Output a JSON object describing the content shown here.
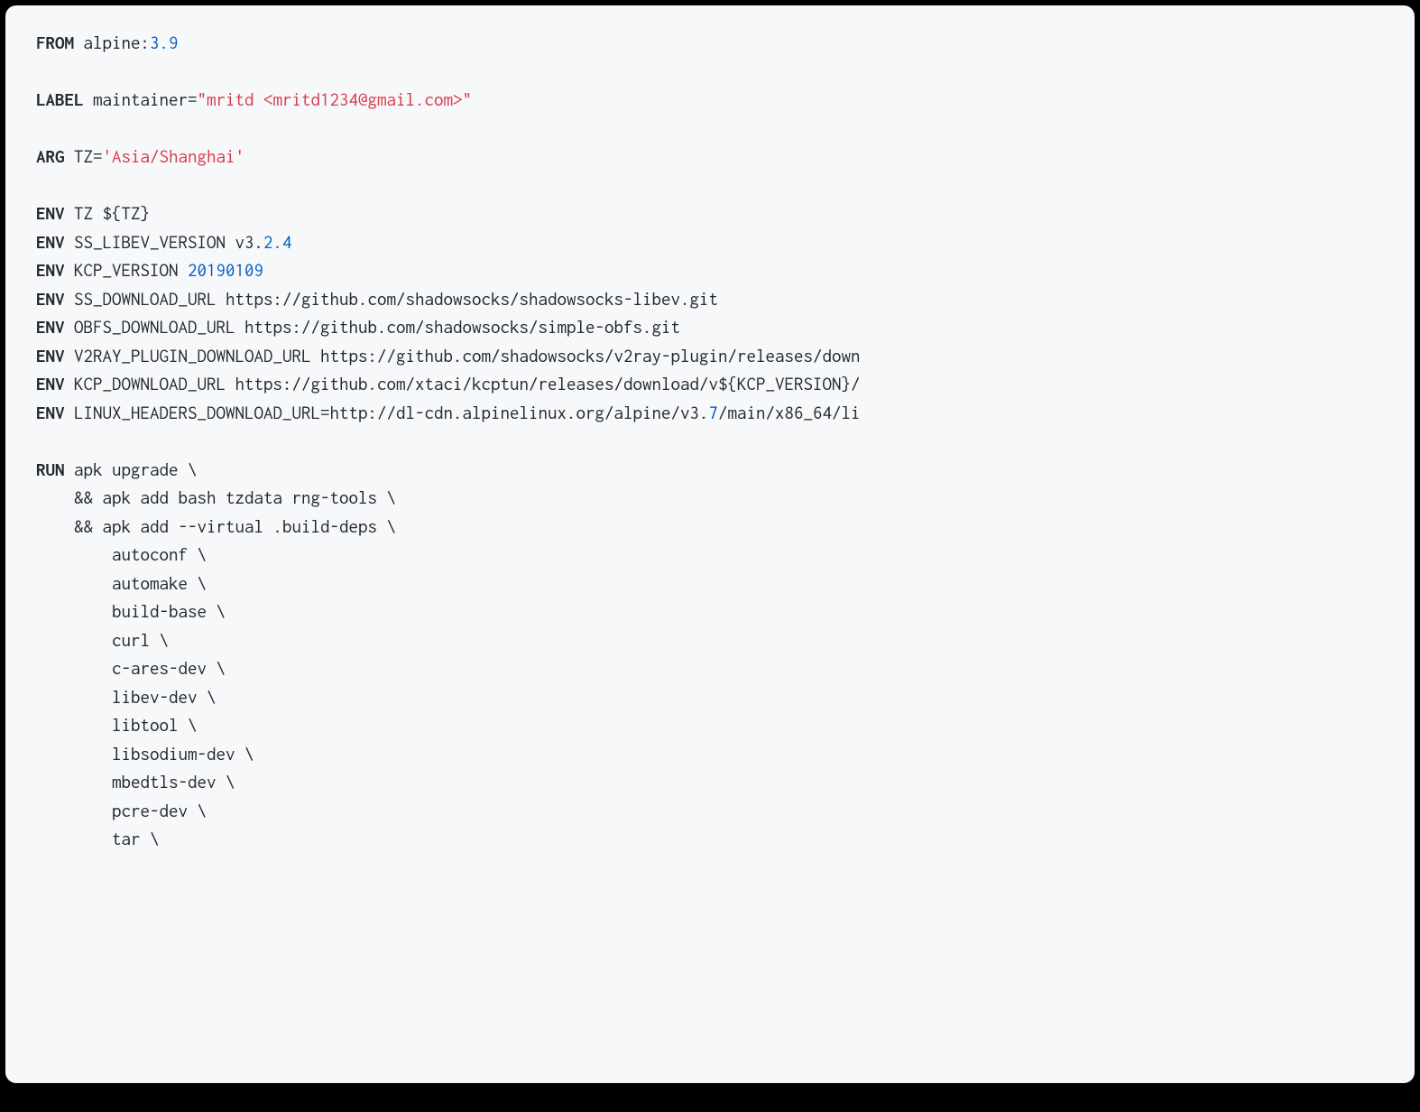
{
  "code": {
    "from_kw": "FROM",
    "from_val_pre": " alpine:",
    "from_num": "3.9",
    "blank1": "",
    "label_kw": "LABEL",
    "label_pre": " maintainer=",
    "label_str": "\"mritd <mritd1234@gmail.com>\"",
    "blank2": "",
    "arg_kw": "ARG",
    "arg_pre": " TZ=",
    "arg_str": "'Asia/Shanghai'",
    "blank3": "",
    "env1_kw": "ENV",
    "env1_val": " TZ ${TZ}",
    "env2_kw": "ENV",
    "env2_val_pre": " SS_LIBEV_VERSION v3.",
    "env2_num": "2.4",
    "env3_kw": "ENV",
    "env3_val_pre": " KCP_VERSION ",
    "env3_num": "20190109",
    "env4_kw": "ENV",
    "env4_val": " SS_DOWNLOAD_URL https://github.com/shadowsocks/shadowsocks-libev.git",
    "env5_kw": "ENV",
    "env5_val": " OBFS_DOWNLOAD_URL https://github.com/shadowsocks/simple-obfs.git",
    "env6_kw": "ENV",
    "env6_val": " V2RAY_PLUGIN_DOWNLOAD_URL https://github.com/shadowsocks/v2ray-plugin/releases/down",
    "env7_kw": "ENV",
    "env7_val": " KCP_DOWNLOAD_URL https://github.com/xtaci/kcptun/releases/download/v${KCP_VERSION}/",
    "env8_kw": "ENV",
    "env8_val_pre": " LINUX_HEADERS_DOWNLOAD_URL=http://dl-cdn.alpinelinux.org/alpine/v3.",
    "env8_num": "7",
    "env8_val_post": "/main/x86_64/li",
    "blank4": "",
    "run_kw": "RUN",
    "run_l1": " apk upgrade \\",
    "run_l2": "    && apk add bash tzdata rng-tools \\",
    "run_l3": "    && apk add --virtual .build-deps \\",
    "run_l4": "        autoconf \\",
    "run_l5": "        automake \\",
    "run_l6": "        build-base \\",
    "run_l7": "        curl \\",
    "run_l8": "        c-ares-dev \\",
    "run_l9": "        libev-dev \\",
    "run_l10": "        libtool \\",
    "run_l11": "        libsodium-dev \\",
    "run_l12": "        mbedtls-dev \\",
    "run_l13": "        pcre-dev \\",
    "run_l14": "        tar \\"
  }
}
